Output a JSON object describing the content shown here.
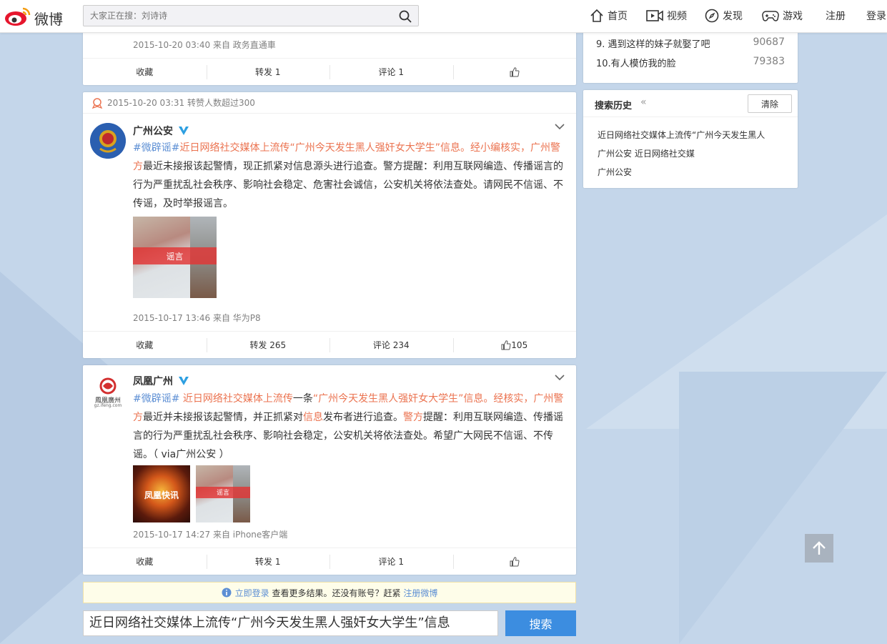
{
  "nav": {
    "logo_text": "微博",
    "search_placeholder": "大家正在搜：刘诗诗",
    "home": "首页",
    "video": "视频",
    "discover": "发现",
    "game": "游戏",
    "register": "注册",
    "login": "登录"
  },
  "card0": {
    "meta": "2015-10-20 03:40 来自 政务直通車",
    "actions": {
      "collect": "收藏",
      "repost": "转发 1",
      "comment": "评论 1",
      "like": ""
    }
  },
  "card1": {
    "head": "2015-10-20 03:31 转赞人数超过300",
    "author": "广州公安",
    "text": {
      "hashtag": "#微辟谣#",
      "red1": "近日网络社交媒体上流传“广州今天发生黑人强奸女大学生”信息。经小编核实，广州警方",
      "black1": "最近未接报该起警情，现正抓紧对信息源头进行追查。警方提醒：利用互联网编造、传播谣言的行为严重扰乱社会秩序、影响社会稳定、危害社会诚信，公安机关将依法查处。请网民不信谣、不传谣，及时举报谣言。"
    },
    "image_label": "谣言",
    "meta": "2015-10-17 13:46 来自 华为P8",
    "actions": {
      "collect": "收藏",
      "repost": "转发 265",
      "comment": "评论 234",
      "like": "105"
    }
  },
  "card2": {
    "author": "凤凰广州",
    "avatar_caption": "鳳凰廣州",
    "avatar_sub": "gz.ifeng.com",
    "text": {
      "hashtag": "#微辟谣#",
      "red1": " 近日网络社交媒体上流传",
      "black1": "一条",
      "red2": "“广州今天发生黑人强奸女大学生”信息。经核实，广州警方",
      "black2": "最近并未接报该起警情，并正抓紧对",
      "red3": "信息",
      "black3": "发布者进行追查。",
      "red4": "警方",
      "black4": "提醒：利用互联网编造、传播谣言的行为严重扰乱社会秩序、影响社会稳定，公安机关将依法查处。希望广大网民不信谣、不传谣。（ via广州公安 ）"
    },
    "image1_label": "凤凰快讯",
    "image2_label": "谣言",
    "meta": "2015-10-17 14:27 来自 iPhone客户端",
    "actions": {
      "collect": "收藏",
      "repost": "转发 1",
      "comment": "评论 1",
      "like": ""
    }
  },
  "hot": {
    "rows": [
      {
        "title": "9.  遇到这样的妹子就娶了吧",
        "num": "90687"
      },
      {
        "title": "10.有人模仿我的脸",
        "num": "79383"
      }
    ]
  },
  "history": {
    "title": "搜索历史",
    "collapse": "«",
    "clear": "清除",
    "items": [
      "近日网络社交媒体上流传“广州今天发生黑人",
      "广州公安 近日网络社交媒",
      "广州公安"
    ]
  },
  "login_bar": {
    "login_link": "立即登录",
    "text1": " 查看更多结果。还没有账号？赶紧 ",
    "register_link": "注册微博"
  },
  "bottom": {
    "query": "近日网络社交媒体上流传“广州今天发生黑人强奸女大学生”信息",
    "button": "搜索"
  },
  "colors": {
    "accent": "#eb7350",
    "link": "#5d8fd4",
    "button": "#3c8de0",
    "background": "#c4d6ea"
  }
}
